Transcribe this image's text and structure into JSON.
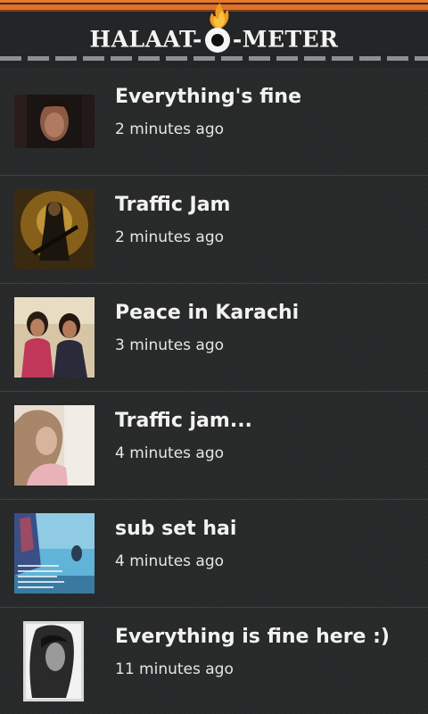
{
  "app": {
    "logo_left": "HALAAT-",
    "logo_right": "-METER",
    "logo_icon": "fire-meter-icon",
    "accent_color": "#e0712a"
  },
  "feed": {
    "items": [
      {
        "title": "Everything's fine",
        "time": "2 minutes ago",
        "thumb": "man-portrait-photo"
      },
      {
        "title": "Traffic Jam",
        "time": "2 minutes ago",
        "thumb": "armed-figure-poster"
      },
      {
        "title": "Peace in Karachi",
        "time": "3 minutes ago",
        "thumb": "two-women-photo"
      },
      {
        "title": "Traffic jam...",
        "time": "4 minutes ago",
        "thumb": "woman-soft-focus-photo"
      },
      {
        "title": "sub set hai",
        "time": "4 minutes ago",
        "thumb": "blue-sky-quote-image"
      },
      {
        "title": "Everything is fine here :)",
        "time": "11 minutes ago",
        "thumb": "bw-sketch-portrait"
      }
    ]
  }
}
